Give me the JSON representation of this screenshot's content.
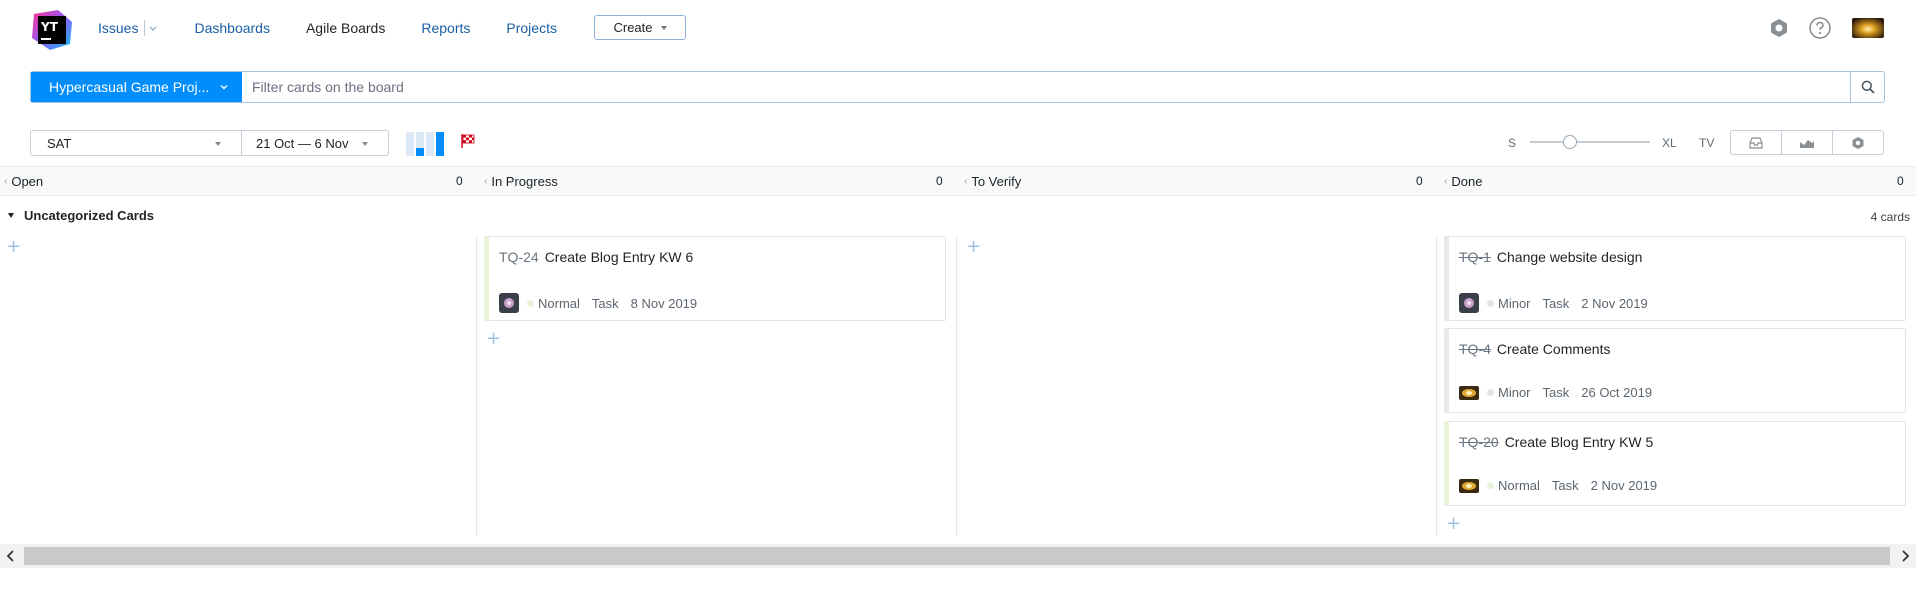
{
  "header": {
    "logo_text": "YT",
    "nav": {
      "issues": "Issues",
      "dashboards": "Dashboards",
      "agile_boards": "Agile Boards",
      "reports": "Reports",
      "projects": "Projects"
    },
    "create_label": "Create",
    "icons": [
      "hub-icon",
      "help-icon",
      "user-avatar"
    ]
  },
  "search": {
    "board_name": "Hypercasual Game Proj...",
    "placeholder": "Filter cards on the board"
  },
  "toolbar": {
    "sprint": "SAT",
    "date_range": "21 Oct — 6 Nov",
    "size_small": "S",
    "size_large": "XL",
    "size_tv": "TV",
    "buttons": [
      "backlog-icon",
      "chart-icon",
      "settings-icon"
    ]
  },
  "columns": [
    {
      "name": "Open",
      "count": "0"
    },
    {
      "name": "In Progress",
      "count": "0"
    },
    {
      "name": "To Verify",
      "count": "0"
    },
    {
      "name": "Done",
      "count": "0"
    }
  ],
  "swimlane": {
    "title": "Uncategorized Cards",
    "count": "4 cards"
  },
  "cards": {
    "in_progress": [
      {
        "id": "TQ-24",
        "summary": "Create Blog Entry KW 6",
        "priority": "Normal",
        "type": "Task",
        "date": "8 Nov 2019"
      }
    ],
    "done": [
      {
        "id": "TQ-1",
        "summary": "Change website design",
        "priority": "Minor",
        "type": "Task",
        "date": "2 Nov 2019"
      },
      {
        "id": "TQ-4",
        "summary": "Create Comments",
        "priority": "Minor",
        "type": "Task",
        "date": "26 Oct 2019"
      },
      {
        "id": "TQ-20",
        "summary": "Create Blog Entry KW 5",
        "priority": "Normal",
        "type": "Task",
        "date": "2 Nov 2019"
      }
    ]
  },
  "colors": {
    "accent": "#008eff",
    "link": "#1a5fa6",
    "normal_priority": "#e8f2d7",
    "minor_priority": "#e0e3e6"
  }
}
